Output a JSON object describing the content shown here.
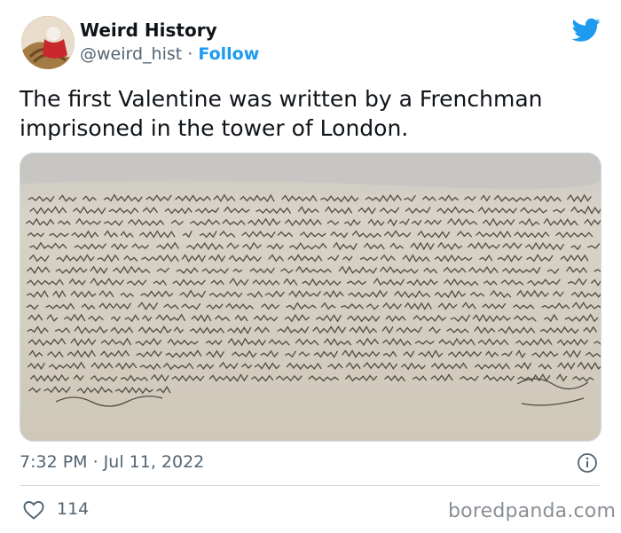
{
  "author": {
    "display_name": "Weird History",
    "handle": "@weird_hist",
    "separator": "·",
    "follow_label": "Follow"
  },
  "tweet": {
    "text": "The first Valentine was written by a Frenchman imprisoned in the tower of London."
  },
  "media": {
    "description_icon": "handwritten-letter-image"
  },
  "meta": {
    "timestamp": "7:32 PM · Jul 11, 2022"
  },
  "engagement": {
    "likes": "114"
  },
  "watermark": "boredpanda.com",
  "colors": {
    "accent": "#1d9bf0",
    "text": "#0f1419",
    "secondary": "#536471",
    "border": "#cfd9de"
  }
}
